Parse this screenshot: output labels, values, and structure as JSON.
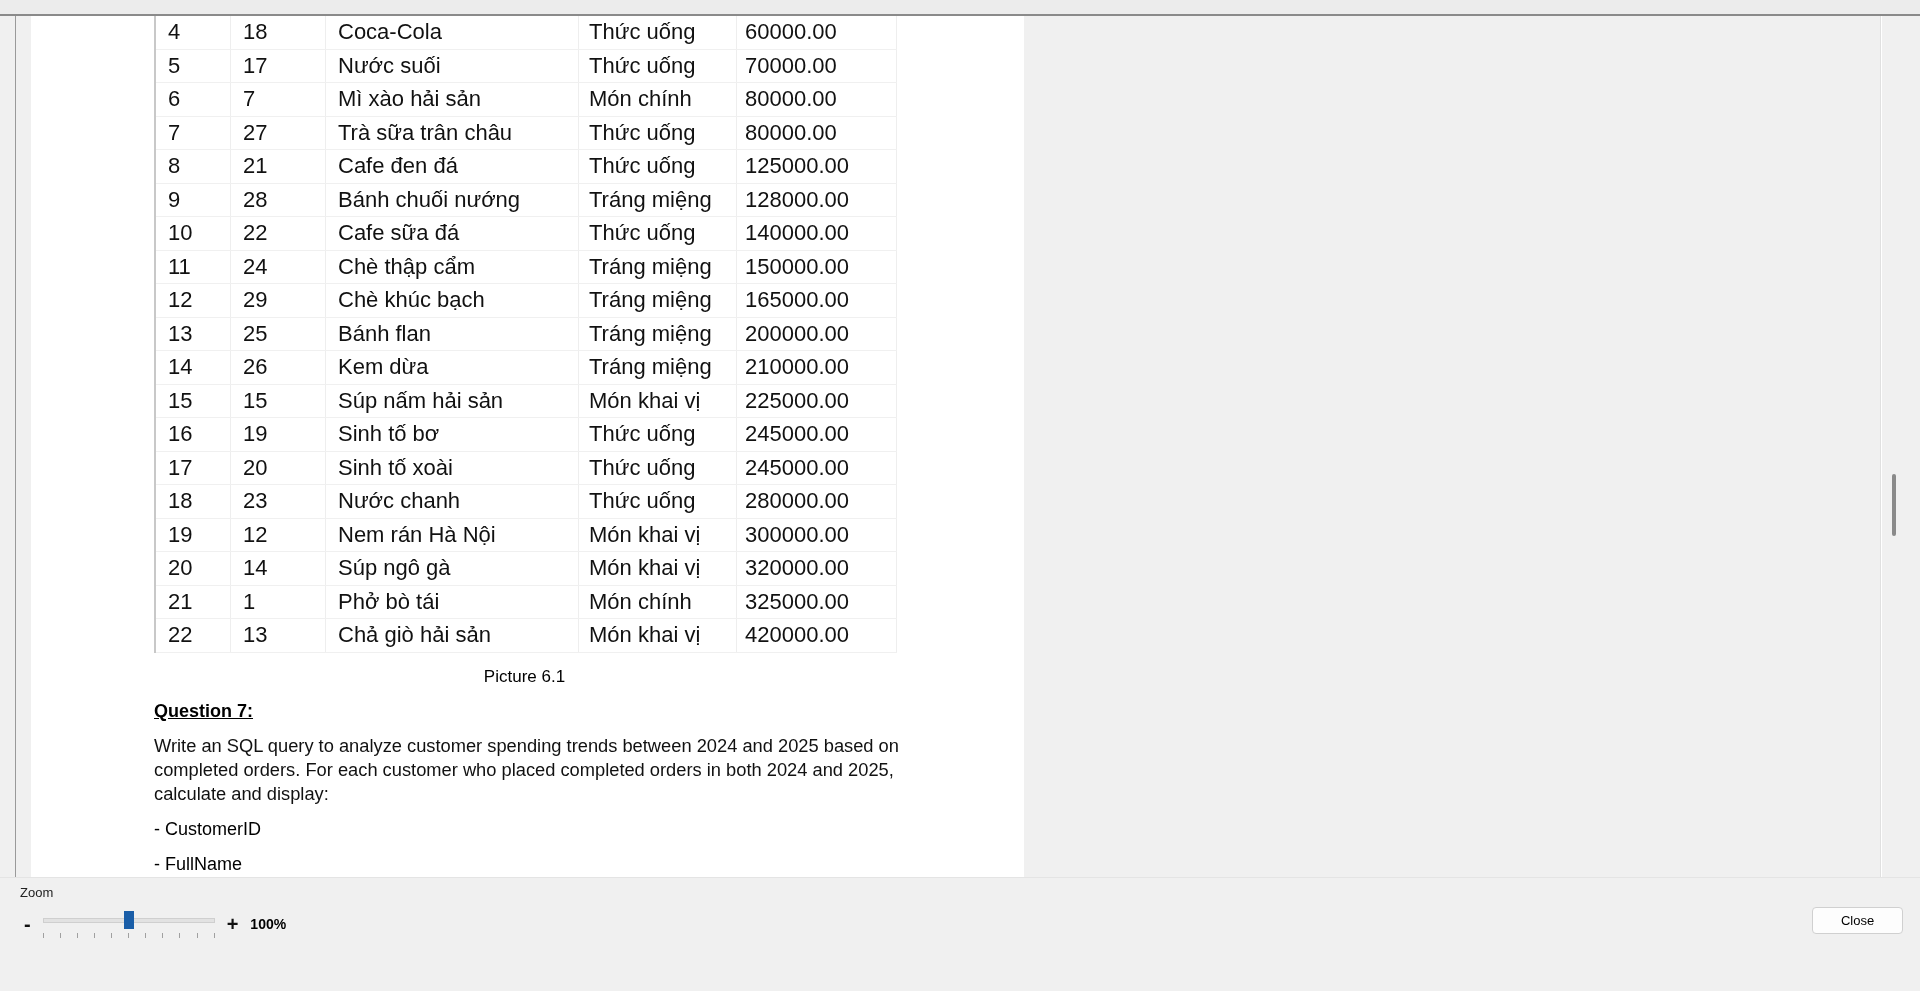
{
  "table": {
    "rows": [
      [
        "4",
        "18",
        "Coca-Cola",
        "Thức uống",
        "60000.00"
      ],
      [
        "5",
        "17",
        "Nước suối",
        "Thức uống",
        "70000.00"
      ],
      [
        "6",
        "7",
        "Mì xào hải sản",
        "Món chính",
        "80000.00"
      ],
      [
        "7",
        "27",
        "Trà sữa trân châu",
        "Thức uống",
        "80000.00"
      ],
      [
        "8",
        "21",
        "Cafe đen đá",
        "Thức uống",
        "125000.00"
      ],
      [
        "9",
        "28",
        "Bánh chuối nướng",
        "Tráng miệng",
        "128000.00"
      ],
      [
        "10",
        "22",
        "Cafe sữa đá",
        "Thức uống",
        "140000.00"
      ],
      [
        "11",
        "24",
        "Chè thập cẩm",
        "Tráng miệng",
        "150000.00"
      ],
      [
        "12",
        "29",
        "Chè khúc bạch",
        "Tráng miệng",
        "165000.00"
      ],
      [
        "13",
        "25",
        "Bánh flan",
        "Tráng miệng",
        "200000.00"
      ],
      [
        "14",
        "26",
        "Kem dừa",
        "Tráng miệng",
        "210000.00"
      ],
      [
        "15",
        "15",
        "Súp nấm hải sản",
        "Món khai vị",
        "225000.00"
      ],
      [
        "16",
        "19",
        "Sinh tố bơ",
        "Thức uống",
        "245000.00"
      ],
      [
        "17",
        "20",
        "Sinh tố xoài",
        "Thức uống",
        "245000.00"
      ],
      [
        "18",
        "23",
        "Nước chanh",
        "Thức uống",
        "280000.00"
      ],
      [
        "19",
        "12",
        "Nem rán Hà Nội",
        "Món khai vị",
        "300000.00"
      ],
      [
        "20",
        "14",
        "Súp ngô gà",
        "Món khai vị",
        "320000.00"
      ],
      [
        "21",
        "1",
        "Phở bò tái",
        "Món chính",
        "325000.00"
      ],
      [
        "22",
        "13",
        "Chả giò hải sản",
        "Món khai vị",
        "420000.00"
      ]
    ]
  },
  "caption": "Picture 6.1",
  "question": {
    "heading": "Question 7:",
    "text": "Write an SQL query to analyze customer spending trends between 2024 and 2025 based on completed orders. For each customer who placed completed orders in both 2024 and 2025, calculate and display:",
    "items": [
      "- CustomerID",
      "- FullName"
    ]
  },
  "zoom": {
    "label": "Zoom",
    "minus": "-",
    "plus": "+",
    "level": 0.5,
    "value": "100%"
  },
  "buttons": [
    "Close"
  ]
}
